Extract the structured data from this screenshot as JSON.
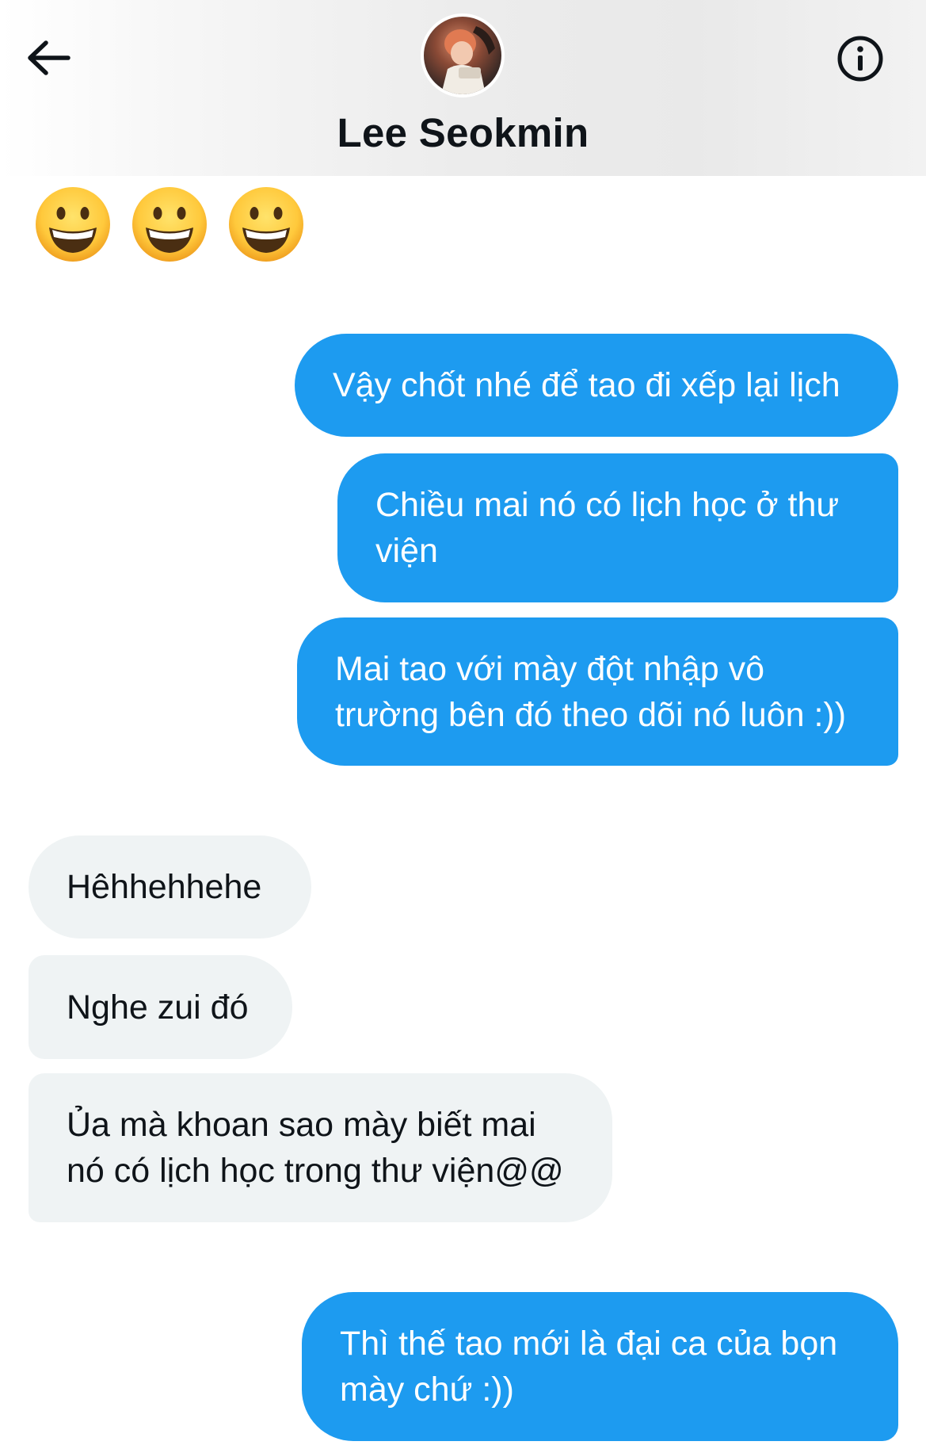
{
  "header": {
    "contact_name": "Lee Seokmin",
    "back_icon": "arrow-left-icon",
    "info_icon": "info-circle-icon"
  },
  "emoji_message": {
    "emojis": [
      "😀",
      "😀",
      "😀"
    ]
  },
  "messages": [
    {
      "direction": "outgoing",
      "text": "Vậy chốt nhé để tao đi xếp lại lịch"
    },
    {
      "direction": "outgoing",
      "text": "Chiều mai nó có lịch học ở thư\nviện"
    },
    {
      "direction": "outgoing",
      "text": "Mai tao với mày đột nhập vô\ntrường bên đó theo dõi nó luôn :))"
    },
    {
      "direction": "incoming",
      "text": "Hêhhehhehe"
    },
    {
      "direction": "incoming",
      "text": "Nghe zui đó"
    },
    {
      "direction": "incoming",
      "text": "Ủa mà khoan sao mày biết mai\nnó có lịch học trong thư viện@@"
    },
    {
      "direction": "outgoing",
      "text": "Thì thế tao mới là đại ca của bọn\nmày chứ :))"
    }
  ],
  "colors": {
    "outgoing_bubble": "#1d9bf0",
    "incoming_bubble": "#eff3f4",
    "text_primary": "#0f1419"
  }
}
